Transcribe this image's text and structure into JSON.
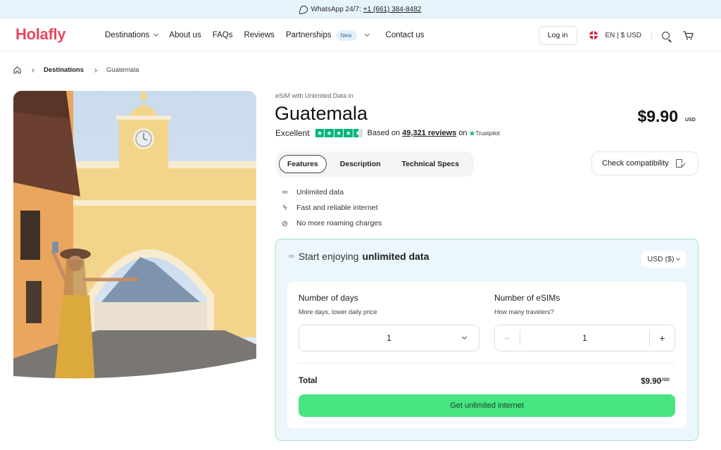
{
  "topbar": {
    "label": "WhatsApp 24/7:",
    "phone": "+1 (661) 384-8482"
  },
  "header": {
    "logo": "Holafly",
    "nav": [
      {
        "label": "Destinations",
        "dropdown": true
      },
      {
        "label": "About us"
      },
      {
        "label": "FAQs"
      },
      {
        "label": "Reviews"
      },
      {
        "label": "Partnerships",
        "badge": "New",
        "dropdown": true
      },
      {
        "label": "Contact us"
      }
    ],
    "login_label": "Log in",
    "locale": "EN | $ USD",
    "icons": [
      "uk-flag-icon",
      "search-icon",
      "cart-icon"
    ]
  },
  "breadcrumb": {
    "home_icon": "home-icon",
    "items": [
      "Destinations",
      "Guatemala"
    ]
  },
  "hero": {
    "alt": "Woman in yellow dress taking a selfie under the Santa Catalina Arch with a volcano in the background"
  },
  "product": {
    "eyebrow": "eSIM with Unlimited Data in",
    "title": "Guatemala",
    "rating_label": "Excellent",
    "rating_stars": 4.5,
    "reviews_prefix": "Based on",
    "reviews_count": "49,321 reviews",
    "reviews_on": "on",
    "review_source": "Trustpilot",
    "price": "$9.90",
    "currency": "USD"
  },
  "tabs": [
    {
      "label": "Features",
      "active": true
    },
    {
      "label": "Description",
      "active": false
    },
    {
      "label": "Technical Specs",
      "active": false
    }
  ],
  "check_compatibility_label": "Check compatibility",
  "features": [
    {
      "icon": "infinity-icon",
      "label": "Unlimited data"
    },
    {
      "icon": "lightning-icon",
      "label": "Fast and reliable internet"
    },
    {
      "icon": "no-roaming-icon",
      "label": "No more roaming charges"
    }
  ],
  "purchase": {
    "heading_prefix": "Start enjoying",
    "heading_bold": "unlimited data",
    "currency_select": "USD ($)",
    "days": {
      "label": "Number of days",
      "sublabel": "More days, lower daily price",
      "value": "1"
    },
    "esims": {
      "label": "Number of eSIMs",
      "sublabel": "How many travelers?",
      "value": "1",
      "minus": "−",
      "plus": "+"
    },
    "total_label": "Total",
    "total_value": "$9.90",
    "total_currency": "USD",
    "cta_label": "Get unlimited internet"
  },
  "colors": {
    "brand": "#e6485f",
    "cta": "#48e583",
    "trustpilot": "#00b67a",
    "card_bg": "#ecf7fc",
    "card_border": "#a9e3c4",
    "topbar_bg": "#e8f4fb"
  }
}
